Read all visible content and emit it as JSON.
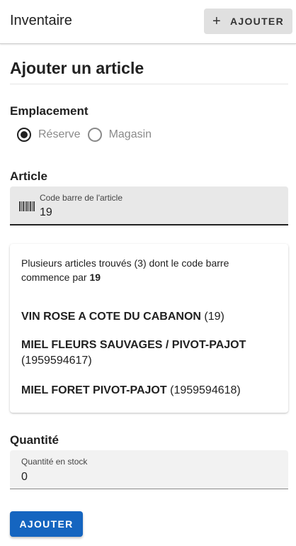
{
  "appbar": {
    "title": "Inventaire",
    "add_button": {
      "icon": "+",
      "label": "AJOUTER"
    }
  },
  "page": {
    "title": "Ajouter un article"
  },
  "location": {
    "label": "Emplacement",
    "options": [
      {
        "label": "Réserve",
        "checked": true
      },
      {
        "label": "Magasin",
        "checked": false
      }
    ]
  },
  "article": {
    "label": "Article",
    "barcode_field": {
      "label": "Code barre de l'article",
      "value": "19"
    }
  },
  "results": {
    "message_prefix": "Plusieurs articles trouvés (3) dont le code barre commence par",
    "message_code": "19",
    "items": [
      {
        "name": "VIN ROSE A COTE DU CABANON",
        "code": "(19)"
      },
      {
        "name": "MIEL FLEURS SAUVAGES / PIVOT-PAJOT",
        "code": "(1959594617)"
      },
      {
        "name": "MIEL FORET PIVOT-PAJOT",
        "code": "(1959594618)"
      }
    ]
  },
  "quantity": {
    "label": "Quantité",
    "field": {
      "label": "Quantité en stock",
      "value": "0"
    }
  },
  "submit": {
    "label": "AJOUTER"
  },
  "colors": {
    "primary": "#1565c0",
    "field_bg": "#e8e8e8",
    "muted_text": "#8a8a8a"
  }
}
